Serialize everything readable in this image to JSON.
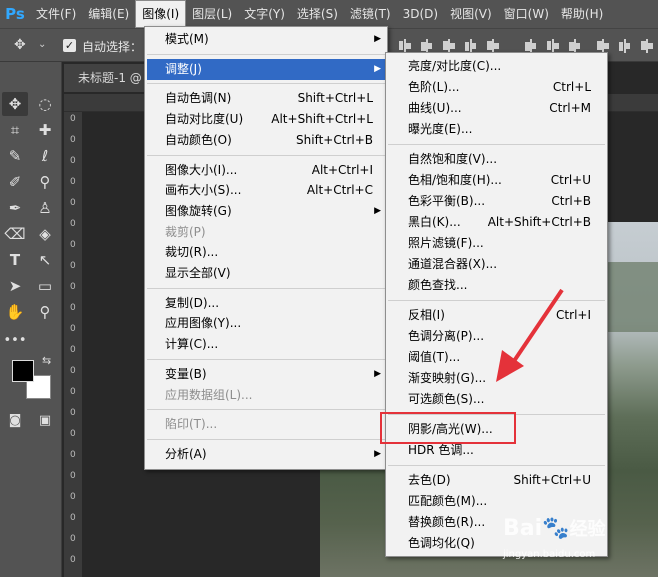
{
  "app": {
    "logo": "Ps"
  },
  "menubar": {
    "items": [
      "文件(F)",
      "编辑(E)",
      "图像(I)",
      "图层(L)",
      "文字(Y)",
      "选择(S)",
      "滤镜(T)",
      "3D(D)",
      "视图(V)",
      "窗口(W)",
      "帮助(H)"
    ],
    "active_index": 2
  },
  "options_bar": {
    "auto_select_label": "自动选择：",
    "auto_select_checked": true
  },
  "document": {
    "tab_title": "未标题-1 @"
  },
  "rulers": {
    "left_digits": [
      "0",
      "0",
      "0",
      "0",
      "0",
      "0",
      "0",
      "0",
      "0",
      "0",
      "0",
      "0",
      "0",
      "0",
      "0",
      "0",
      "0",
      "0",
      "0",
      "0",
      "0",
      "0"
    ]
  },
  "image_menu": {
    "groups": [
      [
        {
          "label": "模式(M)",
          "shortcut": "",
          "submenu": true
        }
      ],
      [
        {
          "label": "调整(J)",
          "shortcut": "",
          "submenu": true,
          "highlighted": true
        }
      ],
      [
        {
          "label": "自动色调(N)",
          "shortcut": "Shift+Ctrl+L"
        },
        {
          "label": "自动对比度(U)",
          "shortcut": "Alt+Shift+Ctrl+L"
        },
        {
          "label": "自动颜色(O)",
          "shortcut": "Shift+Ctrl+B"
        }
      ],
      [
        {
          "label": "图像大小(I)...",
          "shortcut": "Alt+Ctrl+I"
        },
        {
          "label": "画布大小(S)...",
          "shortcut": "Alt+Ctrl+C"
        },
        {
          "label": "图像旋转(G)",
          "shortcut": "",
          "submenu": true
        },
        {
          "label": "裁剪(P)",
          "shortcut": "",
          "disabled": true
        },
        {
          "label": "裁切(R)...",
          "shortcut": ""
        },
        {
          "label": "显示全部(V)",
          "shortcut": ""
        }
      ],
      [
        {
          "label": "复制(D)...",
          "shortcut": ""
        },
        {
          "label": "应用图像(Y)...",
          "shortcut": ""
        },
        {
          "label": "计算(C)...",
          "shortcut": ""
        }
      ],
      [
        {
          "label": "变量(B)",
          "shortcut": "",
          "submenu": true
        },
        {
          "label": "应用数据组(L)...",
          "shortcut": "",
          "disabled": true
        }
      ],
      [
        {
          "label": "陷印(T)...",
          "shortcut": "",
          "disabled": true
        }
      ],
      [
        {
          "label": "分析(A)",
          "shortcut": "",
          "submenu": true
        }
      ]
    ]
  },
  "adjust_menu": {
    "groups": [
      [
        {
          "label": "亮度/对比度(C)...",
          "shortcut": ""
        },
        {
          "label": "色阶(L)...",
          "shortcut": "Ctrl+L"
        },
        {
          "label": "曲线(U)...",
          "shortcut": "Ctrl+M"
        },
        {
          "label": "曝光度(E)...",
          "shortcut": ""
        }
      ],
      [
        {
          "label": "自然饱和度(V)...",
          "shortcut": ""
        },
        {
          "label": "色相/饱和度(H)...",
          "shortcut": "Ctrl+U"
        },
        {
          "label": "色彩平衡(B)...",
          "shortcut": "Ctrl+B"
        },
        {
          "label": "黑白(K)...",
          "shortcut": "Alt+Shift+Ctrl+B"
        },
        {
          "label": "照片滤镜(F)...",
          "shortcut": ""
        },
        {
          "label": "通道混合器(X)...",
          "shortcut": ""
        },
        {
          "label": "颜色查找...",
          "shortcut": ""
        }
      ],
      [
        {
          "label": "反相(I)",
          "shortcut": "Ctrl+I"
        },
        {
          "label": "色调分离(P)...",
          "shortcut": ""
        },
        {
          "label": "阈值(T)...",
          "shortcut": ""
        },
        {
          "label": "渐变映射(G)...",
          "shortcut": ""
        },
        {
          "label": "可选颜色(S)...",
          "shortcut": ""
        }
      ],
      [
        {
          "label": "阴影/高光(W)...",
          "shortcut": "",
          "annotated": true
        },
        {
          "label": "HDR 色调...",
          "shortcut": ""
        }
      ],
      [
        {
          "label": "去色(D)",
          "shortcut": "Shift+Ctrl+U"
        },
        {
          "label": "匹配颜色(M)...",
          "shortcut": ""
        },
        {
          "label": "替换颜色(R)...",
          "shortcut": ""
        },
        {
          "label": "色调均化(Q)",
          "shortcut": ""
        }
      ]
    ]
  },
  "colors": {
    "highlight": "#316ac5",
    "annotation": "#e4323a",
    "foreground": "#000000",
    "background": "#ffffff"
  },
  "watermark": {
    "brand": "Bai",
    "brand_suffix": "经验",
    "url": "jingyan.baidu.com"
  }
}
